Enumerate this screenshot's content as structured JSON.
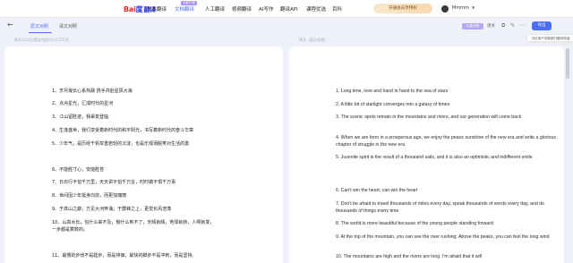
{
  "nav": {
    "logo_brand": "Bai",
    "logo_paw": "度",
    "logo_suffix": "翻译",
    "items": [
      "文本翻译",
      "文档翻译",
      "人工翻译",
      "视频翻译",
      "AI写作",
      "翻译API",
      "课程优选",
      "百科"
    ],
    "active_index": 1,
    "badge": "全新升级",
    "vip_button": "开通会员享特权",
    "username": "Mmmm"
  },
  "toolbar": {
    "tabs": [
      "原文对照",
      "译文对照"
    ],
    "active_tab": 0,
    "chip": "中英对照",
    "tool_text": "译文",
    "translate_button": "导出",
    "tooltip": "试试用户词典提升翻译质量"
  },
  "hints": {
    "left": "原文(2/2页)提取内容共计2,371字",
    "right": "译文（英文结果）"
  },
  "source_lines": [
    "1、岁月凝长心系热融  携手共赴星辰大海",
    "2、点点星光，汇成时代的星河",
    "3、江山留胜迹，我辈复登临",
    "4、生逢盛世，我们享受着新时代的和平阳光，书写着新时代的奋斗华章",
    "5、少年气，是历经千帆举重若轻的沉淀，也是乐观洒脱笑对生活的勇",
    "6、不能胜寸心，安能胜苍",
    "7、日日行不怕千万里，天天讲不怕千万言，时时做不惧千万事",
    "8、世间因少年挺身向前，而更加瑰丽",
    "9、于高山之巅，方见大河奔涌；于群峰之上，更觉长风浩荡",
    "10、山高水长，怕什么来不及，慌什么到不了，天晴就晴，地球就转，人啊就变，",
    "一步都是算数的。",
    "11、最慢的步伐不是跬步，而是徘徊；最快的脚步不是冲刺，而是坚持。"
  ],
  "target_lines": [
    "1. Long time, love and hand in hand to the sea of stars",
    "2. A little bit of starlight converges into a galaxy of times",
    "3. The scenic spots remain in the mountains and rivers, and our generation will come back",
    "4. When we are born in a prosperous age, we enjoy the peace sunshine of the new era and write a glorious chapter of struggle in the new era",
    "5. Juvenile spirit is the result of a thousand sails, and it is also an optimistic and indifferent smile",
    "6. Can't win the heart, can win the heart",
    "7. Don't be afraid to travel thousands of miles every day, speak thousands of words every day, and do thousands of things every time",
    "8. The world is more beautiful because of the young people standing forward",
    "9. At the top of the mountain, you can see the river rushing; Above the peaks, you can feel the long wind",
    "10. The mountains are high and the rivers are long. I'm afraid that it will"
  ]
}
